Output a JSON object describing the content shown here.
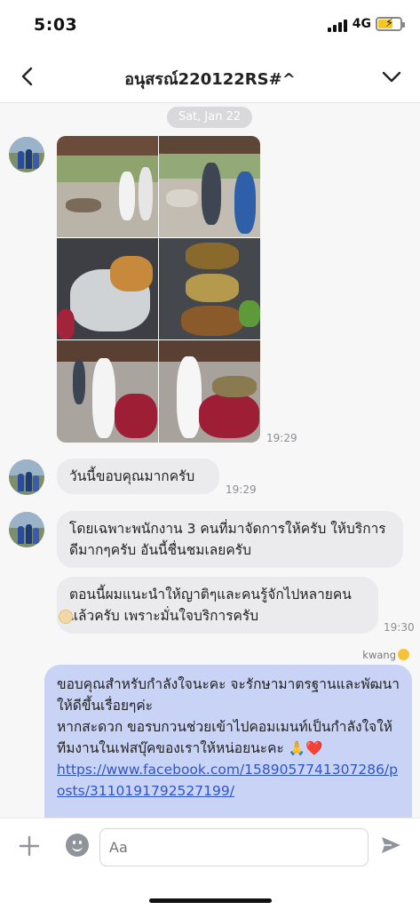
{
  "status": {
    "time": "5:03",
    "network": "4G",
    "battery_color": "#f3c623"
  },
  "header": {
    "title": "อนุสรณ์220122RS#^",
    "back_icon": "chevron-left-icon",
    "menu_icon": "chevron-down-icon"
  },
  "chat": {
    "date": "Sat, Jan 22",
    "photo_time": "19:29",
    "messages": [
      {
        "text": "วันนี้ขอบคุณมากครับ",
        "time": "19:29"
      },
      {
        "text": "โดยเฉพาะพนักงาน 3 คนที่มาจัดการให้ครับ ให้บริการดีมากๆครับ อันนี้ชื่นชมเลยครับ"
      },
      {
        "text": "ตอนนี้ผมแนะนำให้ญาติๆและคนรู้จักไปหลายคนแล้วครับ เพราะมั่นใจบริการครับ",
        "time": "19:30"
      }
    ],
    "reply": {
      "sender": "kwang",
      "line1": "ขอบคุณสำหรับกำลังใจนะคะ จะรักษามาตรฐานและพัฒนาให้ดีขึ้นเรื่อยๆค่ะ",
      "line2": "หากสะดวก ขอรบกวนช่วยเข้าไปคอมเมนท์เป็นกำลังใจให้ทีมงานในเฟสบุ๊คของเราให้หน่อยนะคะ 🙏❤️",
      "link": "https://www.facebook.com/1589057741307286/posts/3110191792527199/"
    }
  },
  "input": {
    "placeholder": "Aa"
  },
  "colors": {
    "incoming_bubble": "#ebebee",
    "outgoing_bubble": "#c9d3f5",
    "link": "#2f55c8"
  }
}
